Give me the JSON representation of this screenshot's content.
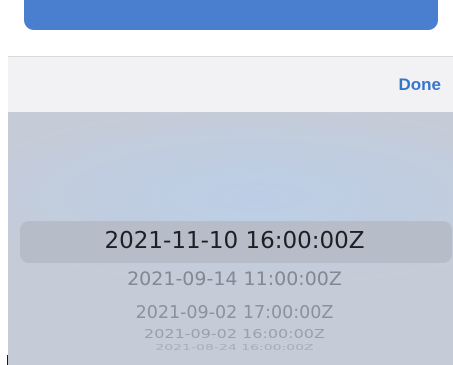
{
  "toolbar": {
    "done_label": "Done"
  },
  "picker": {
    "selected": "2021-11-10 16:00:00Z",
    "options": [
      "2021-09-14 11:00:00Z",
      "2021-09-02 17:00:00Z",
      "2021-09-02 16:00:00Z",
      "2021-08-24 16:00:00Z"
    ]
  },
  "colors": {
    "accent": "#3576cc",
    "button": "#4a7fcf",
    "picker_background": "#c6ccd7",
    "selection_band": "#b6bcc8"
  }
}
